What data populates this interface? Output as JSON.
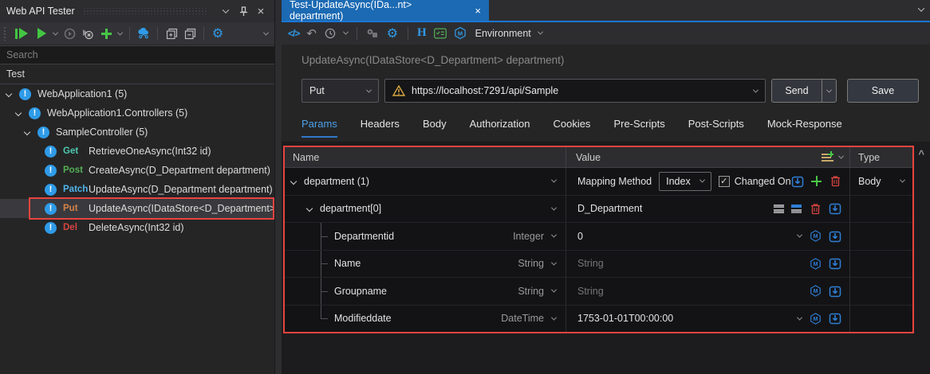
{
  "colors": {
    "tab_blue": "#1b6ab3",
    "tab_underline_blue": "#1c77d4",
    "accent_icon_blue": "#2f9be8",
    "run_green": "#42c642",
    "annotation_red": "#e8443f",
    "warning_yellow": "#d9a741",
    "params_active_blue": "#4ba0e8",
    "method_get": "#4ec9b0",
    "method_post": "#54b054",
    "method_patch": "#4fb3e8",
    "method_put": "#d7824a",
    "method_del": "#d64541"
  },
  "icons": {
    "code_glyph": "</>",
    "undo_glyph": "↶",
    "gear_glyph": "⚙",
    "headers_glyph": "H",
    "close_glyph": "×",
    "check_glyph": "✓",
    "scroll_up_glyph": "^"
  },
  "leftPanel": {
    "title": "Web API Tester",
    "searchPlaceholder": "Search",
    "rootLabel": "Test",
    "tree": [
      {
        "label": "WebApplication1 (5)"
      },
      {
        "label": "WebApplication1.Controllers (5)"
      },
      {
        "label": "SampleController (5)"
      },
      {
        "method": "Get",
        "label": "RetrieveOneAsync(Int32 id)"
      },
      {
        "method": "Post",
        "label": "CreateAsync(D_Department department)"
      },
      {
        "method": "Patch",
        "label": "UpdateAsync(D_Department department)"
      },
      {
        "method": "Put",
        "label": "UpdateAsync(IDataStore<D_Department> dep"
      },
      {
        "method": "Del",
        "label": "DeleteAsync(Int32 id)"
      }
    ]
  },
  "editor": {
    "tabTitle": "Test-UpdateAsync(IDa...nt> department)",
    "environmentLabel": "Environment",
    "requestTitle": "UpdateAsync(IDataStore<D_Department> department)",
    "method": "Put",
    "url": "https://localhost:7291/api/Sample",
    "sendLabel": "Send",
    "saveLabel": "Save",
    "tabs": [
      {
        "label": "Params"
      },
      {
        "label": "Headers"
      },
      {
        "label": "Body"
      },
      {
        "label": "Authorization"
      },
      {
        "label": "Cookies"
      },
      {
        "label": "Pre-Scripts"
      },
      {
        "label": "Post-Scripts"
      },
      {
        "label": "Mock-Response"
      }
    ],
    "activeTab": "Params",
    "table": {
      "columns": {
        "name": "Name",
        "value": "Value",
        "type": "Type"
      },
      "rows": [
        {
          "name": "department (1)",
          "mappingLabel": "Mapping Method",
          "mappingValue": "Index",
          "checkboxLabel": "Changed On",
          "checked": true,
          "type": "Body"
        },
        {
          "name": "department[0]",
          "value": "D_Department"
        },
        {
          "name": "Departmentid",
          "datatype": "Integer",
          "value": "0"
        },
        {
          "name": "Name",
          "datatype": "String",
          "placeholder": "String"
        },
        {
          "name": "Groupname",
          "datatype": "String",
          "placeholder": "String"
        },
        {
          "name": "Modifieddate",
          "datatype": "DateTime",
          "value": "1753-01-01T00:00:00"
        }
      ]
    }
  }
}
